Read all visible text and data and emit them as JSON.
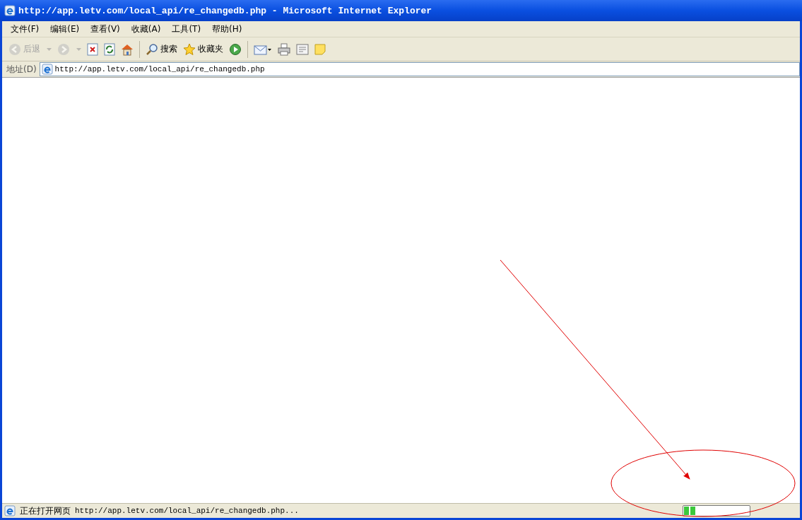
{
  "window": {
    "title": "http://app.letv.com/local_api/re_changedb.php - Microsoft Internet Explorer"
  },
  "menu": [
    "文件(F)",
    "编辑(E)",
    "查看(V)",
    "收藏(A)",
    "工具(T)",
    "帮助(H)"
  ],
  "toolbar": [
    {
      "kind": "back",
      "label": "后退",
      "disabled": true
    },
    {
      "kind": "forward",
      "disabled": true
    },
    {
      "kind": "stop",
      "disabled": false
    },
    {
      "kind": "refresh",
      "disabled": false
    },
    {
      "kind": "home",
      "disabled": false
    },
    {
      "kind": "separator"
    },
    {
      "kind": "search",
      "label": "搜索",
      "disabled": false
    },
    {
      "kind": "favorites",
      "label": "收藏夹",
      "disabled": false
    },
    {
      "kind": "media",
      "disabled": false
    },
    {
      "kind": "separator"
    },
    {
      "kind": "mail",
      "disabled": false
    },
    {
      "kind": "print",
      "disabled": false
    },
    {
      "kind": "edit",
      "disabled": false
    },
    {
      "kind": "note",
      "disabled": false
    }
  ],
  "address_bar": {
    "label": "地址(D)",
    "value": "http://app.letv.com/local_api/re_changedb.php"
  },
  "status_bar": {
    "status": "正在打开网页",
    "url": "http://app.letv.com/local_api/re_changedb.php...",
    "progress": {
      "level": 0.2
    }
  },
  "annotations": {
    "arrow": true,
    "ellipse": true
  }
}
